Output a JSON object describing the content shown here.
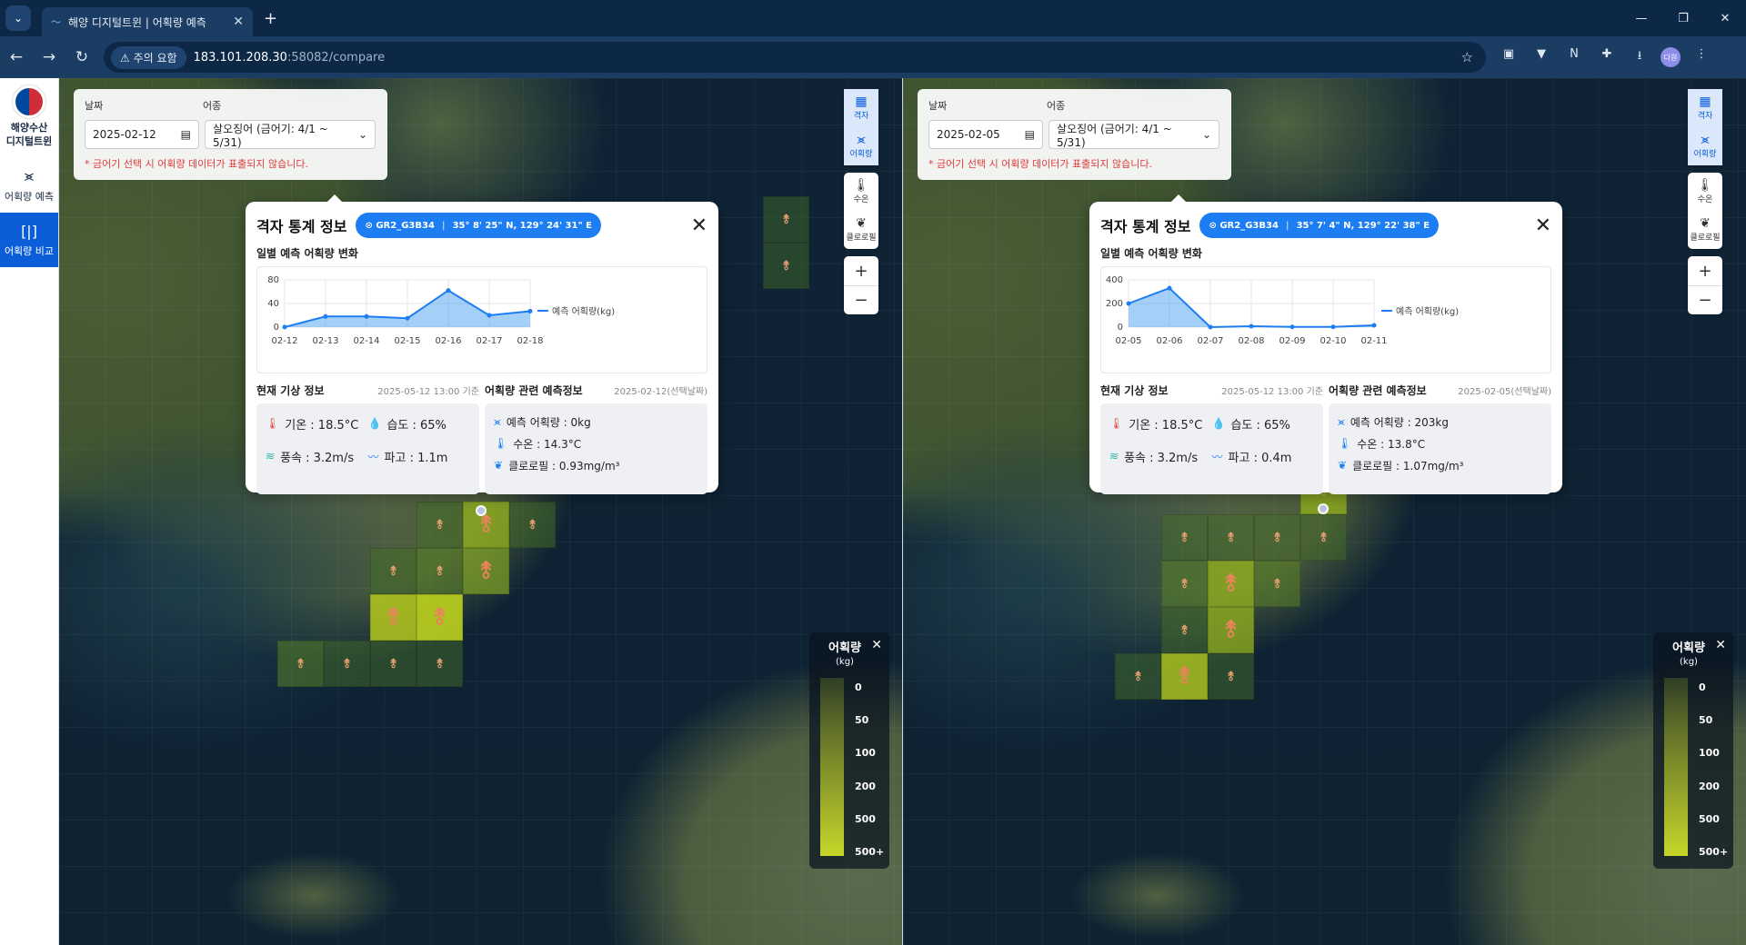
{
  "browser": {
    "tab_title": "해양 디지털트윈 | 어획량 예측",
    "warning_label": "주의 요함",
    "url_host": "183.101.208.30",
    "url_rest": ":58082/compare",
    "profile_label": "다원"
  },
  "sidebar": {
    "logo_text": "해양수산\n디지털트윈",
    "items": [
      {
        "label": "어획량 예측",
        "icon": "fish-icon"
      },
      {
        "label": "어획량 비교",
        "icon": "compare-icon"
      }
    ]
  },
  "panels": [
    {
      "filter": {
        "date_label": "날짜",
        "species_label": "어종",
        "date_value": "2025-02-12",
        "species_value": "살오징어 (금어기: 4/1 ~ 5/31)",
        "note": "* 금어기 선택 시 어획량 데이터가 표출되지 않습니다."
      },
      "controls": {
        "grid": "격자",
        "catch": "어획량",
        "temp": "수온",
        "chl": "클로로필",
        "zoom_in": "+",
        "zoom_out": "−"
      },
      "popup": {
        "title": "격자 통계 정보",
        "grid_id": "GR2_G3B34",
        "coords": "35° 8' 25\" N, 129° 24' 31\" E",
        "chart_title": "일별 예측 어획량 변화",
        "weather_title": "현재 기상 정보",
        "weather_time": "2025-05-12 13:00 기준",
        "forecast_title": "어획량 관련 예측정보",
        "forecast_date": "2025-02-12(선택날짜)",
        "temp": "기온 : 18.5°C",
        "humidity": "습도 : 65%",
        "wind": "풍속 : 3.2m/s",
        "wave": "파고 : 1.1m",
        "catch": "예측 어획량 : 0kg",
        "water_temp": "수온 : 14.3°C",
        "chlorophyll": "클로로필 : 0.93mg/m³"
      },
      "chart_data": {
        "type": "area",
        "categories": [
          "02-12",
          "02-13",
          "02-14",
          "02-15",
          "02-16",
          "02-17",
          "02-18"
        ],
        "series": [
          {
            "name": "예측 어획량(kg)",
            "values": [
              0,
              18,
              18,
              15,
              62,
              20,
              27
            ]
          }
        ],
        "yticks": [
          0,
          40,
          80
        ],
        "ylim": [
          0,
          80
        ]
      },
      "legend": {
        "title": "어획량",
        "unit": "(kg)",
        "values": [
          "0",
          "50",
          "100",
          "200",
          "500",
          "500+"
        ]
      }
    },
    {
      "filter": {
        "date_label": "날짜",
        "species_label": "어종",
        "date_value": "2025-02-05",
        "species_value": "살오징어 (금어기: 4/1 ~ 5/31)",
        "note": "* 금어기 선택 시 어획량 데이터가 표출되지 않습니다."
      },
      "controls": {
        "grid": "격자",
        "catch": "어획량",
        "temp": "수온",
        "chl": "클로로필",
        "zoom_in": "+",
        "zoom_out": "−"
      },
      "popup": {
        "title": "격자 통계 정보",
        "grid_id": "GR2_G3B34",
        "coords": "35° 7' 4\" N, 129° 22' 38\" E",
        "chart_title": "일별 예측 어획량 변화",
        "weather_title": "현재 기상 정보",
        "weather_time": "2025-05-12 13:00 기준",
        "forecast_title": "어획량 관련 예측정보",
        "forecast_date": "2025-02-05(선택날짜)",
        "temp": "기온 : 18.5°C",
        "humidity": "습도 : 65%",
        "wind": "풍속 : 3.2m/s",
        "wave": "파고 : 0.4m",
        "catch": "예측 어획량 : 203kg",
        "water_temp": "수온 : 13.8°C",
        "chlorophyll": "클로로필 : 1.07mg/m³"
      },
      "chart_data": {
        "type": "area",
        "categories": [
          "02-05",
          "02-06",
          "02-07",
          "02-08",
          "02-09",
          "02-10",
          "02-11"
        ],
        "series": [
          {
            "name": "예측 어획량(kg)",
            "values": [
              200,
              330,
              0,
              8,
              2,
              2,
              15
            ]
          }
        ],
        "yticks": [
          0,
          200,
          400
        ],
        "ylim": [
          0,
          400
        ]
      },
      "legend": {
        "title": "어획량",
        "unit": "(kg)",
        "values": [
          "0",
          "50",
          "100",
          "200",
          "500",
          "500+"
        ]
      }
    }
  ],
  "colors": {
    "accent": "#1c7ef2",
    "active_menu": "#0b5ed7",
    "warning": "#e03a3a"
  }
}
